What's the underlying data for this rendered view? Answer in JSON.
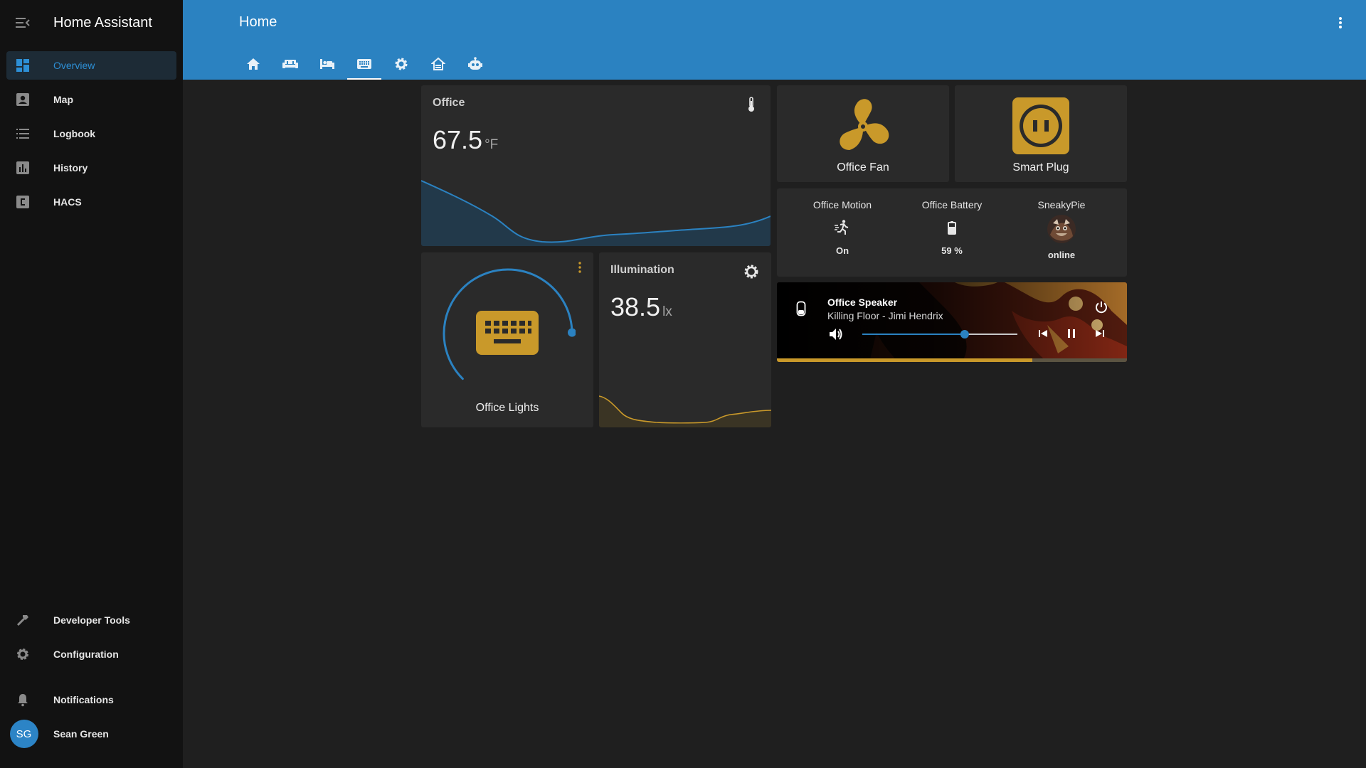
{
  "app": {
    "title": "Home Assistant"
  },
  "sidebar": {
    "items": [
      {
        "label": "Overview",
        "icon": "view-dashboard-icon"
      },
      {
        "label": "Map",
        "icon": "account-box-icon"
      },
      {
        "label": "Logbook",
        "icon": "format-list-icon"
      },
      {
        "label": "History",
        "icon": "chart-box-icon"
      },
      {
        "label": "HACS",
        "icon": "hacs-icon"
      }
    ],
    "bottom": {
      "developer_tools": "Developer Tools",
      "configuration": "Configuration",
      "notifications": "Notifications",
      "user_name": "Sean Green",
      "user_initials": "SG"
    }
  },
  "header": {
    "title": "Home",
    "tabs": [
      {
        "icon": "home-icon"
      },
      {
        "icon": "sofa-icon"
      },
      {
        "icon": "bed-icon"
      },
      {
        "icon": "keyboard-icon",
        "active": true
      },
      {
        "icon": "gear-icon"
      },
      {
        "icon": "home-floor-icon"
      },
      {
        "icon": "robot-icon"
      }
    ]
  },
  "cards": {
    "office_sensor": {
      "title": "Office",
      "value": "67.5",
      "unit": "°F"
    },
    "office_fan": {
      "name": "Office Fan"
    },
    "smart_plug": {
      "name": "Smart Plug"
    },
    "glance": {
      "motion": {
        "name": "Office Motion",
        "state": "On"
      },
      "battery": {
        "name": "Office Battery",
        "state": "59 %"
      },
      "person": {
        "name": "SneakyPie",
        "state": "online"
      }
    },
    "office_lights": {
      "name": "Office Lights",
      "brightness_fraction": 0.83
    },
    "illumination": {
      "title": "Illumination",
      "value": "38.5",
      "unit": "lx"
    },
    "media": {
      "name": "Office Speaker",
      "track": "Killing Floor - Jimi Hendrix",
      "volume_fraction": 0.66,
      "progress_fraction": 0.73
    }
  },
  "colors": {
    "primary": "#2b82c1",
    "accent": "#c9992a",
    "sidebar_bg": "#121212",
    "card_bg": "#2a2a2a"
  }
}
